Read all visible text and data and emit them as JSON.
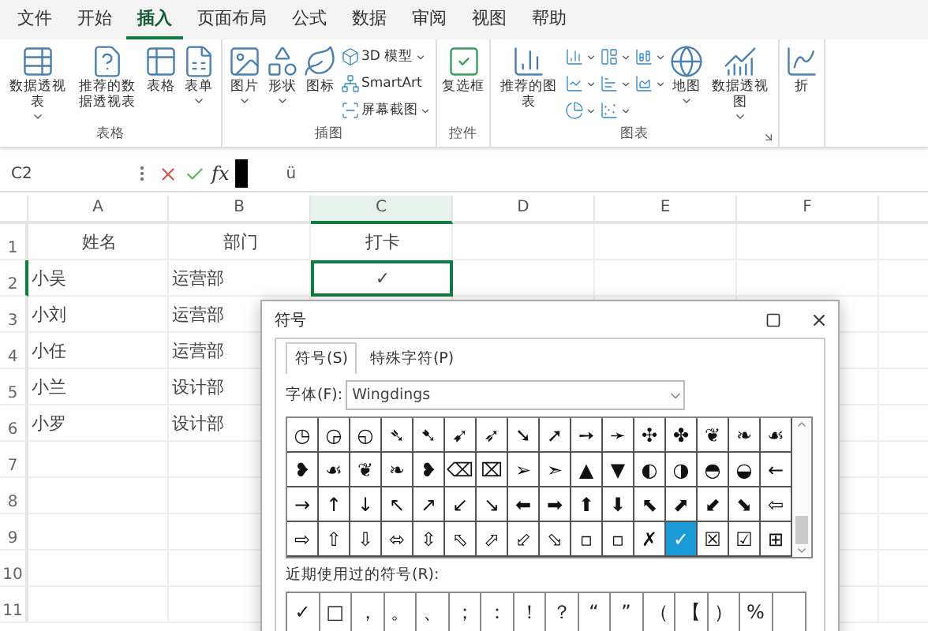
{
  "ribbon": {
    "tabs": [
      {
        "label": "文件",
        "selected": false
      },
      {
        "label": "开始",
        "selected": false
      },
      {
        "label": "插入",
        "selected": true
      },
      {
        "label": "页面布局",
        "selected": false
      },
      {
        "label": "公式",
        "selected": false
      },
      {
        "label": "数据",
        "selected": false
      },
      {
        "label": "审阅",
        "selected": false
      },
      {
        "label": "视图",
        "selected": false
      },
      {
        "label": "帮助",
        "selected": false
      }
    ],
    "groups": [
      {
        "label": "表格",
        "items": [
          {
            "kind": "large",
            "label": "数据透视表",
            "dropdown": true
          },
          {
            "kind": "large",
            "label": "推荐的数据透视表",
            "dropdown": false
          },
          {
            "kind": "large",
            "label": "表格",
            "dropdown": false
          },
          {
            "kind": "large",
            "label": "表单",
            "dropdown": true
          }
        ]
      },
      {
        "label": "插图",
        "items": [
          {
            "kind": "large",
            "label": "图片",
            "dropdown": true
          },
          {
            "kind": "large",
            "label": "形状",
            "dropdown": true
          },
          {
            "kind": "large",
            "label": "图标",
            "dropdown": false
          },
          {
            "kind": "small",
            "label": "3D 模型",
            "dropdown": true
          },
          {
            "kind": "small",
            "label": "SmartArt",
            "dropdown": false
          },
          {
            "kind": "small",
            "label": "屏幕截图",
            "dropdown": true
          }
        ]
      },
      {
        "label": "控件",
        "items": [
          {
            "kind": "large",
            "label": "复选框",
            "dropdown": false
          }
        ]
      },
      {
        "label": "图表",
        "items": [
          {
            "kind": "large",
            "label": "推荐的图表",
            "dropdown": false
          },
          {
            "kind": "icon",
            "dropdown": true
          },
          {
            "kind": "icon",
            "dropdown": true
          },
          {
            "kind": "icon",
            "dropdown": true
          },
          {
            "kind": "icon",
            "dropdown": true
          },
          {
            "kind": "icon",
            "dropdown": true
          },
          {
            "kind": "icon",
            "dropdown": true
          },
          {
            "kind": "icon",
            "dropdown": true
          },
          {
            "kind": "icon",
            "dropdown": true
          },
          {
            "kind": "large",
            "label": "地图",
            "dropdown": true
          },
          {
            "kind": "large",
            "label": "数据透视图",
            "dropdown": true
          }
        ]
      },
      {
        "items": [
          {
            "kind": "large",
            "label": "折",
            "dropdown": false
          }
        ]
      }
    ]
  },
  "formula_bar": {
    "name_box": "C2",
    "fx": "fx",
    "value": "ü"
  },
  "sheet": {
    "columns": [
      {
        "label": "A",
        "selected": false
      },
      {
        "label": "B",
        "selected": false
      },
      {
        "label": "C",
        "selected": true
      },
      {
        "label": "D",
        "selected": false
      },
      {
        "label": "E",
        "selected": false
      },
      {
        "label": "F",
        "selected": false
      }
    ],
    "rows": [
      {
        "number": "1",
        "selected": false,
        "cells": [
          "姓名",
          "部门",
          "打卡"
        ]
      },
      {
        "number": "2",
        "selected": true,
        "cells": [
          "小吴",
          "运营部",
          "✓"
        ]
      },
      {
        "number": "3",
        "selected": false,
        "cells": [
          "小刘",
          "运营部"
        ]
      },
      {
        "number": "4",
        "selected": false,
        "cells": [
          "小任",
          "运营部"
        ]
      },
      {
        "number": "5",
        "selected": false,
        "cells": [
          "小兰",
          "设计部"
        ]
      },
      {
        "number": "6",
        "selected": false,
        "cells": [
          "小罗",
          "设计部"
        ]
      },
      {
        "number": "7",
        "selected": false
      },
      {
        "number": "8",
        "selected": false
      },
      {
        "number": "9",
        "selected": false
      },
      {
        "number": "10",
        "selected": false
      },
      {
        "number": "11",
        "selected": false
      }
    ]
  },
  "dialog": {
    "title": "符号",
    "tabs": [
      {
        "label": "符号(S)",
        "selected": true
      },
      {
        "label": "特殊字符(P)",
        "selected": false
      }
    ],
    "font_label": "字体(F):",
    "font": "Wingdings",
    "symbols": [
      [
        {
          "char": "◷",
          "selected": false
        },
        {
          "char": "◶",
          "selected": false
        },
        {
          "char": "◵",
          "selected": false
        },
        {
          "char": "➴",
          "selected": false
        },
        {
          "char": "➷",
          "selected": false
        },
        {
          "char": "➹",
          "selected": false
        },
        {
          "char": "➶",
          "selected": false
        },
        {
          "char": "➘",
          "selected": false
        },
        {
          "char": "➚",
          "selected": false
        },
        {
          "char": "➙",
          "selected": false
        },
        {
          "char": "➛",
          "selected": false
        },
        {
          "char": "✣",
          "selected": false
        },
        {
          "char": "✤",
          "selected": false
        },
        {
          "char": "❦",
          "selected": false
        },
        {
          "char": "❧",
          "selected": false
        },
        {
          "char": "☙",
          "selected": false
        }
      ],
      [
        {
          "char": "❥",
          "selected": false
        },
        {
          "char": "☙",
          "selected": false
        },
        {
          "char": "❦",
          "selected": false
        },
        {
          "char": "❧",
          "selected": false
        },
        {
          "char": "❥",
          "selected": false
        },
        {
          "char": "⌫",
          "selected": false
        },
        {
          "char": "⌧",
          "selected": false
        },
        {
          "char": "➢",
          "selected": false
        },
        {
          "char": "➣",
          "selected": false
        },
        {
          "char": "▲",
          "selected": false
        },
        {
          "char": "▼",
          "selected": false
        },
        {
          "char": "◐",
          "selected": false
        },
        {
          "char": "◑",
          "selected": false
        },
        {
          "char": "◓",
          "selected": false
        },
        {
          "char": "◒",
          "selected": false
        },
        {
          "char": "←",
          "selected": false
        }
      ],
      [
        {
          "char": "→",
          "selected": false
        },
        {
          "char": "↑",
          "selected": false
        },
        {
          "char": "↓",
          "selected": false
        },
        {
          "char": "↖",
          "selected": false
        },
        {
          "char": "↗",
          "selected": false
        },
        {
          "char": "↙",
          "selected": false
        },
        {
          "char": "↘",
          "selected": false
        },
        {
          "char": "⬅",
          "selected": false
        },
        {
          "char": "➡",
          "selected": false
        },
        {
          "char": "⬆",
          "selected": false
        },
        {
          "char": "⬇",
          "selected": false
        },
        {
          "char": "⬉",
          "selected": false
        },
        {
          "char": "⬈",
          "selected": false
        },
        {
          "char": "⬋",
          "selected": false
        },
        {
          "char": "⬊",
          "selected": false
        },
        {
          "char": "⇦",
          "selected": false
        }
      ],
      [
        {
          "char": "⇨",
          "selected": false
        },
        {
          "char": "⇧",
          "selected": false
        },
        {
          "char": "⇩",
          "selected": false
        },
        {
          "char": "⬄",
          "selected": false
        },
        {
          "char": "⇳",
          "selected": false
        },
        {
          "char": "⬁",
          "selected": false
        },
        {
          "char": "⬀",
          "selected": false
        },
        {
          "char": "⬃",
          "selected": false
        },
        {
          "char": "⬂",
          "selected": false
        },
        {
          "char": "▫",
          "selected": false
        },
        {
          "char": "▫",
          "selected": false
        },
        {
          "char": "✗",
          "selected": false
        },
        {
          "char": "✓",
          "selected": true
        },
        {
          "char": "☒",
          "selected": false
        },
        {
          "char": "☑",
          "selected": false
        },
        {
          "char": "⊞",
          "selected": false
        }
      ]
    ],
    "recent_label": "近期使用过的符号(R):",
    "recent": [
      "✓",
      "□",
      "，",
      "。",
      "、",
      "；",
      "：",
      "！",
      "？",
      "“",
      "”",
      "（",
      "【",
      "）",
      "%"
    ]
  }
}
